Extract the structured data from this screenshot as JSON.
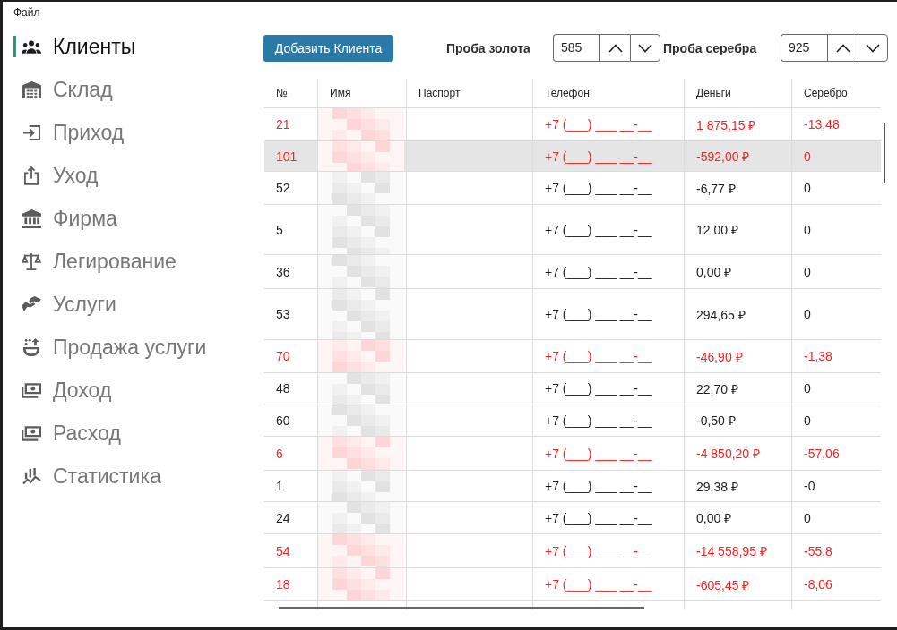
{
  "menu_bar": {
    "items": [
      "Файл"
    ]
  },
  "sidebar": {
    "items": [
      {
        "label": "Клиенты",
        "selected": true
      },
      {
        "label": "Склад",
        "selected": false
      },
      {
        "label": "Приход",
        "selected": false
      },
      {
        "label": "Уход",
        "selected": false
      },
      {
        "label": "Фирма",
        "selected": false
      },
      {
        "label": "Легирование",
        "selected": false
      },
      {
        "label": "Услуги",
        "selected": false
      },
      {
        "label": "Продажа услуги",
        "selected": false
      },
      {
        "label": "Доход",
        "selected": false
      },
      {
        "label": "Расход",
        "selected": false
      },
      {
        "label": "Статистика",
        "selected": false
      }
    ]
  },
  "toolbar": {
    "add_button": "Добавить Клиента",
    "gold_assay": {
      "label": "Проба золота",
      "value": "585"
    },
    "silver_assay": {
      "label": "Проба серебра",
      "value": "925"
    }
  },
  "table": {
    "columns": [
      "№",
      "Имя",
      "Паспорт",
      "Телефон",
      "Деньги",
      "Серебро"
    ],
    "rows": [
      {
        "number": "21",
        "phone": "+7 (___) ___ __-__",
        "money": "1 875,15 ₽",
        "silver": "-13,48",
        "flagged": true,
        "selected": false
      },
      {
        "number": "101",
        "phone": "+7 (___) ___ __-__",
        "money": "-592,00 ₽",
        "silver": "0",
        "flagged": true,
        "selected": true
      },
      {
        "number": "52",
        "phone": "+7 (___) ___ __-__",
        "money": "-6,77 ₽",
        "silver": "0",
        "flagged": false,
        "selected": false
      },
      {
        "number": "5",
        "phone": "+7 (___) ___ __-__",
        "money": "12,00 ₽",
        "silver": "0",
        "flagged": false,
        "selected": false
      },
      {
        "number": "36",
        "phone": "+7 (___) ___ __-__",
        "money": "0,00 ₽",
        "silver": "0",
        "flagged": false,
        "selected": false
      },
      {
        "number": "53",
        "phone": "+7 (___) ___ __-__",
        "money": "294,65 ₽",
        "silver": "0",
        "flagged": false,
        "selected": false
      },
      {
        "number": "70",
        "phone": "+7 (___) ___ __-__",
        "money": "-46,90 ₽",
        "silver": "-1,38",
        "flagged": true,
        "selected": false
      },
      {
        "number": "48",
        "phone": "+7 (___) ___ __-__",
        "money": "22,70 ₽",
        "silver": "0",
        "flagged": false,
        "selected": false
      },
      {
        "number": "60",
        "phone": "+7 (___) ___ __-__",
        "money": "-0,50 ₽",
        "silver": "0",
        "flagged": false,
        "selected": false
      },
      {
        "number": "6",
        "phone": "+7 (___) ___ __-__",
        "money": "-4 850,20 ₽",
        "silver": "-57,06",
        "flagged": true,
        "selected": false
      },
      {
        "number": "1",
        "phone": "+7 (___) ___ __-__",
        "money": "29,38 ₽",
        "silver": "-0",
        "flagged": false,
        "selected": false
      },
      {
        "number": "24",
        "phone": "+7 (___) ___ __-__",
        "money": "0,00 ₽",
        "silver": "0",
        "flagged": false,
        "selected": false
      },
      {
        "number": "54",
        "phone": "+7 (___) ___ __-__",
        "money": "-14 558,95 ₽",
        "silver": "-55,8",
        "flagged": true,
        "selected": false
      },
      {
        "number": "18",
        "phone": "+7 (___) ___ __-__",
        "money": "-605,45 ₽",
        "silver": "-8,06",
        "flagged": true,
        "selected": false
      }
    ]
  }
}
